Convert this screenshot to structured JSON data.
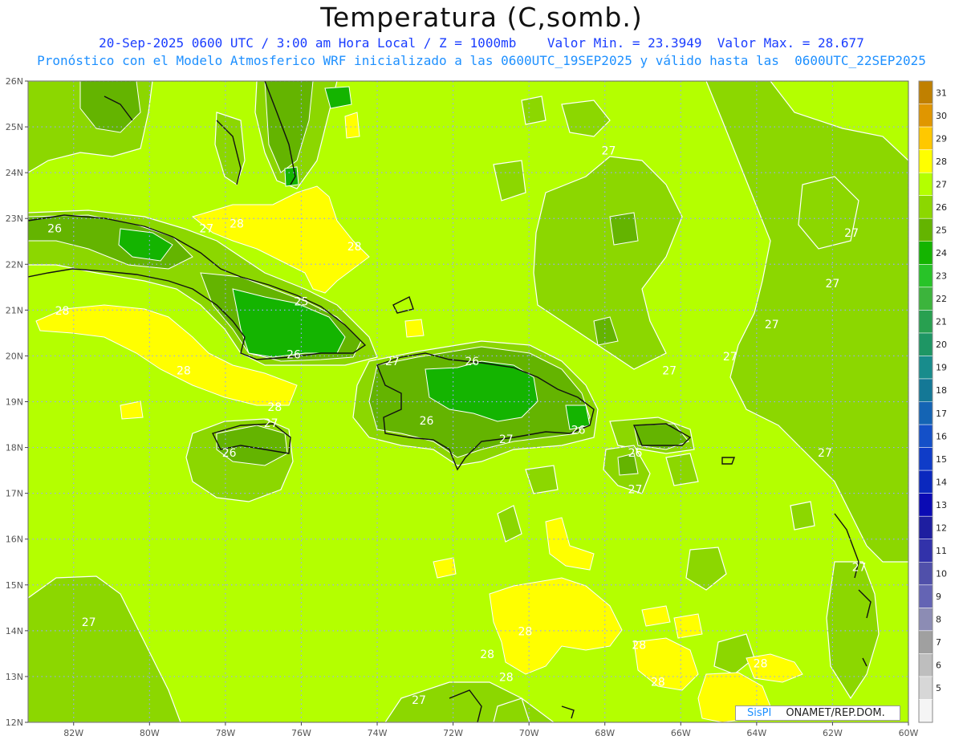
{
  "header": {
    "title": "Temperatura (C,somb.)",
    "line1": "20-Sep-2025 0600 UTC / 3:00 am Hora Local / Z = 1000mb    Valor Min. = 23.3949  Valor Max. = 28.677",
    "line2": "Pronóstico con el Modelo Atmosferico WRF inicializado a las 0600UTC_19SEP2025 y válido hasta las  0600UTC_22SEP2025"
  },
  "map": {
    "lat_labels": [
      "26N",
      "25N",
      "24N",
      "23N",
      "22N",
      "21N",
      "20N",
      "19N",
      "18N",
      "17N",
      "16N",
      "15N",
      "14N",
      "13N",
      "12N"
    ],
    "lon_labels": [
      "82W",
      "80W",
      "78W",
      "76W",
      "74W",
      "72W",
      "70W",
      "68W",
      "66W",
      "64W",
      "62W",
      "60W"
    ],
    "lat_range": [
      12,
      26
    ],
    "lon_range": [
      -83.2,
      -60
    ],
    "contour_labels": [
      {
        "text": "26",
        "lon": -82.5,
        "lat": 22.7
      },
      {
        "text": "27",
        "lon": -78.5,
        "lat": 22.7
      },
      {
        "text": "28",
        "lon": -77.7,
        "lat": 22.8
      },
      {
        "text": "28",
        "lon": -74.6,
        "lat": 22.3
      },
      {
        "text": "25",
        "lon": -76.0,
        "lat": 21.1
      },
      {
        "text": "26",
        "lon": -76.2,
        "lat": 19.95
      },
      {
        "text": "27",
        "lon": -73.6,
        "lat": 19.8
      },
      {
        "text": "28",
        "lon": -82.3,
        "lat": 20.9
      },
      {
        "text": "28",
        "lon": -79.1,
        "lat": 19.6
      },
      {
        "text": "28",
        "lon": -76.7,
        "lat": 18.8
      },
      {
        "text": "27",
        "lon": -76.8,
        "lat": 18.45
      },
      {
        "text": "26",
        "lon": -77.9,
        "lat": 17.8
      },
      {
        "text": "26",
        "lon": -71.5,
        "lat": 19.8
      },
      {
        "text": "26",
        "lon": -72.7,
        "lat": 18.5
      },
      {
        "text": "27",
        "lon": -70.6,
        "lat": 18.1
      },
      {
        "text": "26",
        "lon": -68.7,
        "lat": 18.3
      },
      {
        "text": "26",
        "lon": -67.2,
        "lat": 17.8
      },
      {
        "text": "27",
        "lon": -67.2,
        "lat": 17.0
      },
      {
        "text": "27",
        "lon": -66.3,
        "lat": 19.6
      },
      {
        "text": "27",
        "lon": -67.9,
        "lat": 24.4
      },
      {
        "text": "27",
        "lon": -64.7,
        "lat": 19.9
      },
      {
        "text": "27",
        "lon": -63.6,
        "lat": 20.6
      },
      {
        "text": "27",
        "lon": -62.0,
        "lat": 21.5
      },
      {
        "text": "27",
        "lon": -61.5,
        "lat": 22.6
      },
      {
        "text": "27",
        "lon": -62.2,
        "lat": 17.8
      },
      {
        "text": "27",
        "lon": -61.3,
        "lat": 15.3
      },
      {
        "text": "27",
        "lon": -81.6,
        "lat": 14.1
      },
      {
        "text": "27",
        "lon": -72.9,
        "lat": 12.4
      },
      {
        "text": "28",
        "lon": -70.1,
        "lat": 13.9
      },
      {
        "text": "28",
        "lon": -71.1,
        "lat": 13.4
      },
      {
        "text": "28",
        "lon": -70.6,
        "lat": 12.9
      },
      {
        "text": "28",
        "lon": -67.1,
        "lat": 13.6
      },
      {
        "text": "28",
        "lon": -66.6,
        "lat": 12.8
      },
      {
        "text": "28",
        "lon": -63.9,
        "lat": 13.2
      }
    ]
  },
  "legend": {
    "levels": [
      "31",
      "30",
      "29",
      "28",
      "27",
      "26",
      "25",
      "24",
      "23",
      "22",
      "21",
      "20",
      "19",
      "18",
      "17",
      "16",
      "15",
      "14",
      "13",
      "12",
      "11",
      "10",
      "9",
      "8",
      "7",
      "6",
      "5"
    ],
    "colors": [
      "#c08000",
      "#e09600",
      "#ffc800",
      "#ffff00",
      "#b4ff00",
      "#8cd700",
      "#64b400",
      "#14b400",
      "#28c328",
      "#3cb43c",
      "#28a050",
      "#1e9664",
      "#188c8c",
      "#147896",
      "#1464b4",
      "#1450c8",
      "#0f3cc8",
      "#0a28be",
      "#0a0ab4",
      "#1e1ea0",
      "#3232aa",
      "#5050aa",
      "#6464b4",
      "#8c8cb4",
      "#a0a0a0",
      "#bebebe",
      "#d7d7d7",
      "#f5f5f5"
    ]
  },
  "footer": {
    "brand": "SisPI",
    "org": "ONAMET/REP.DOM."
  }
}
